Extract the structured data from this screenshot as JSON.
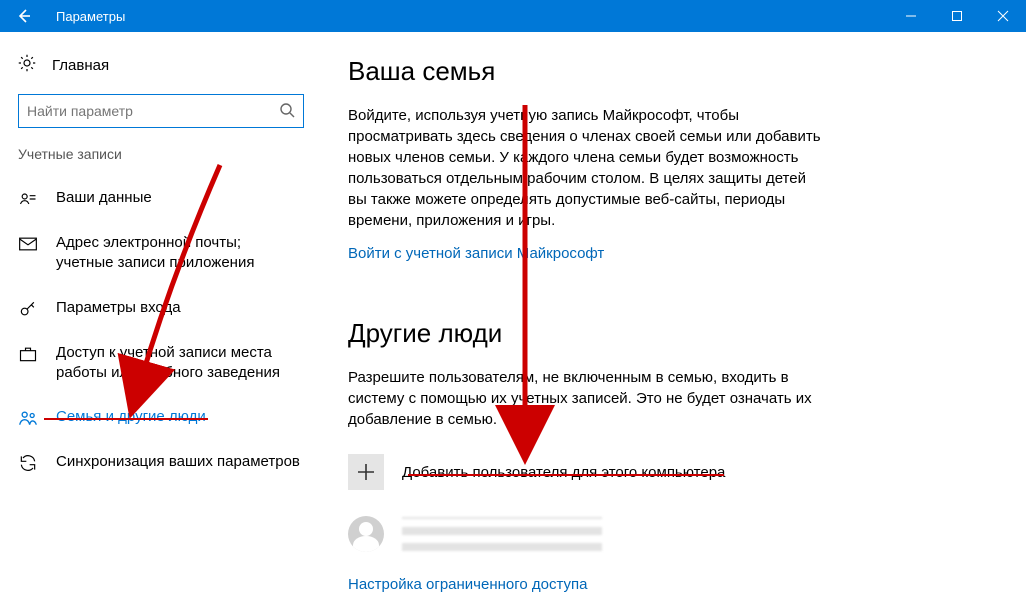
{
  "titlebar": {
    "title": "Параметры"
  },
  "sidebar": {
    "home": "Главная",
    "search_placeholder": "Найти параметр",
    "heading": "Учетные записи",
    "items": [
      {
        "label": "Ваши данные"
      },
      {
        "label": "Адрес электронной почты; учетные записи приложения"
      },
      {
        "label": "Параметры входа"
      },
      {
        "label": "Доступ к учетной записи места работы или учебного заведения"
      },
      {
        "label": "Семья и другие люди"
      },
      {
        "label": "Синхронизация ваших параметров"
      }
    ]
  },
  "main": {
    "family_heading": "Ваша семья",
    "family_body": "Войдите, используя учетную запись Майкрософт, чтобы просматривать здесь сведения о членах своей семьи или добавить новых членов семьи. У каждого члена семьи будет возможность пользоваться отдельным рабочим столом. В целях защиты детей вы также можете определять допустимые веб-сайты, периоды времени, приложения и игры.",
    "family_link": "Войти с учетной записи Майкрософт",
    "other_heading": "Другие люди",
    "other_body": "Разрешите пользователям, не включенным в семью, входить в систему с помощью их учетных записей. Это не будет означать их добавление в семью.",
    "add_user": "Добавить пользователя для этого компьютера",
    "restricted_link": "Настройка ограниченного доступа"
  }
}
